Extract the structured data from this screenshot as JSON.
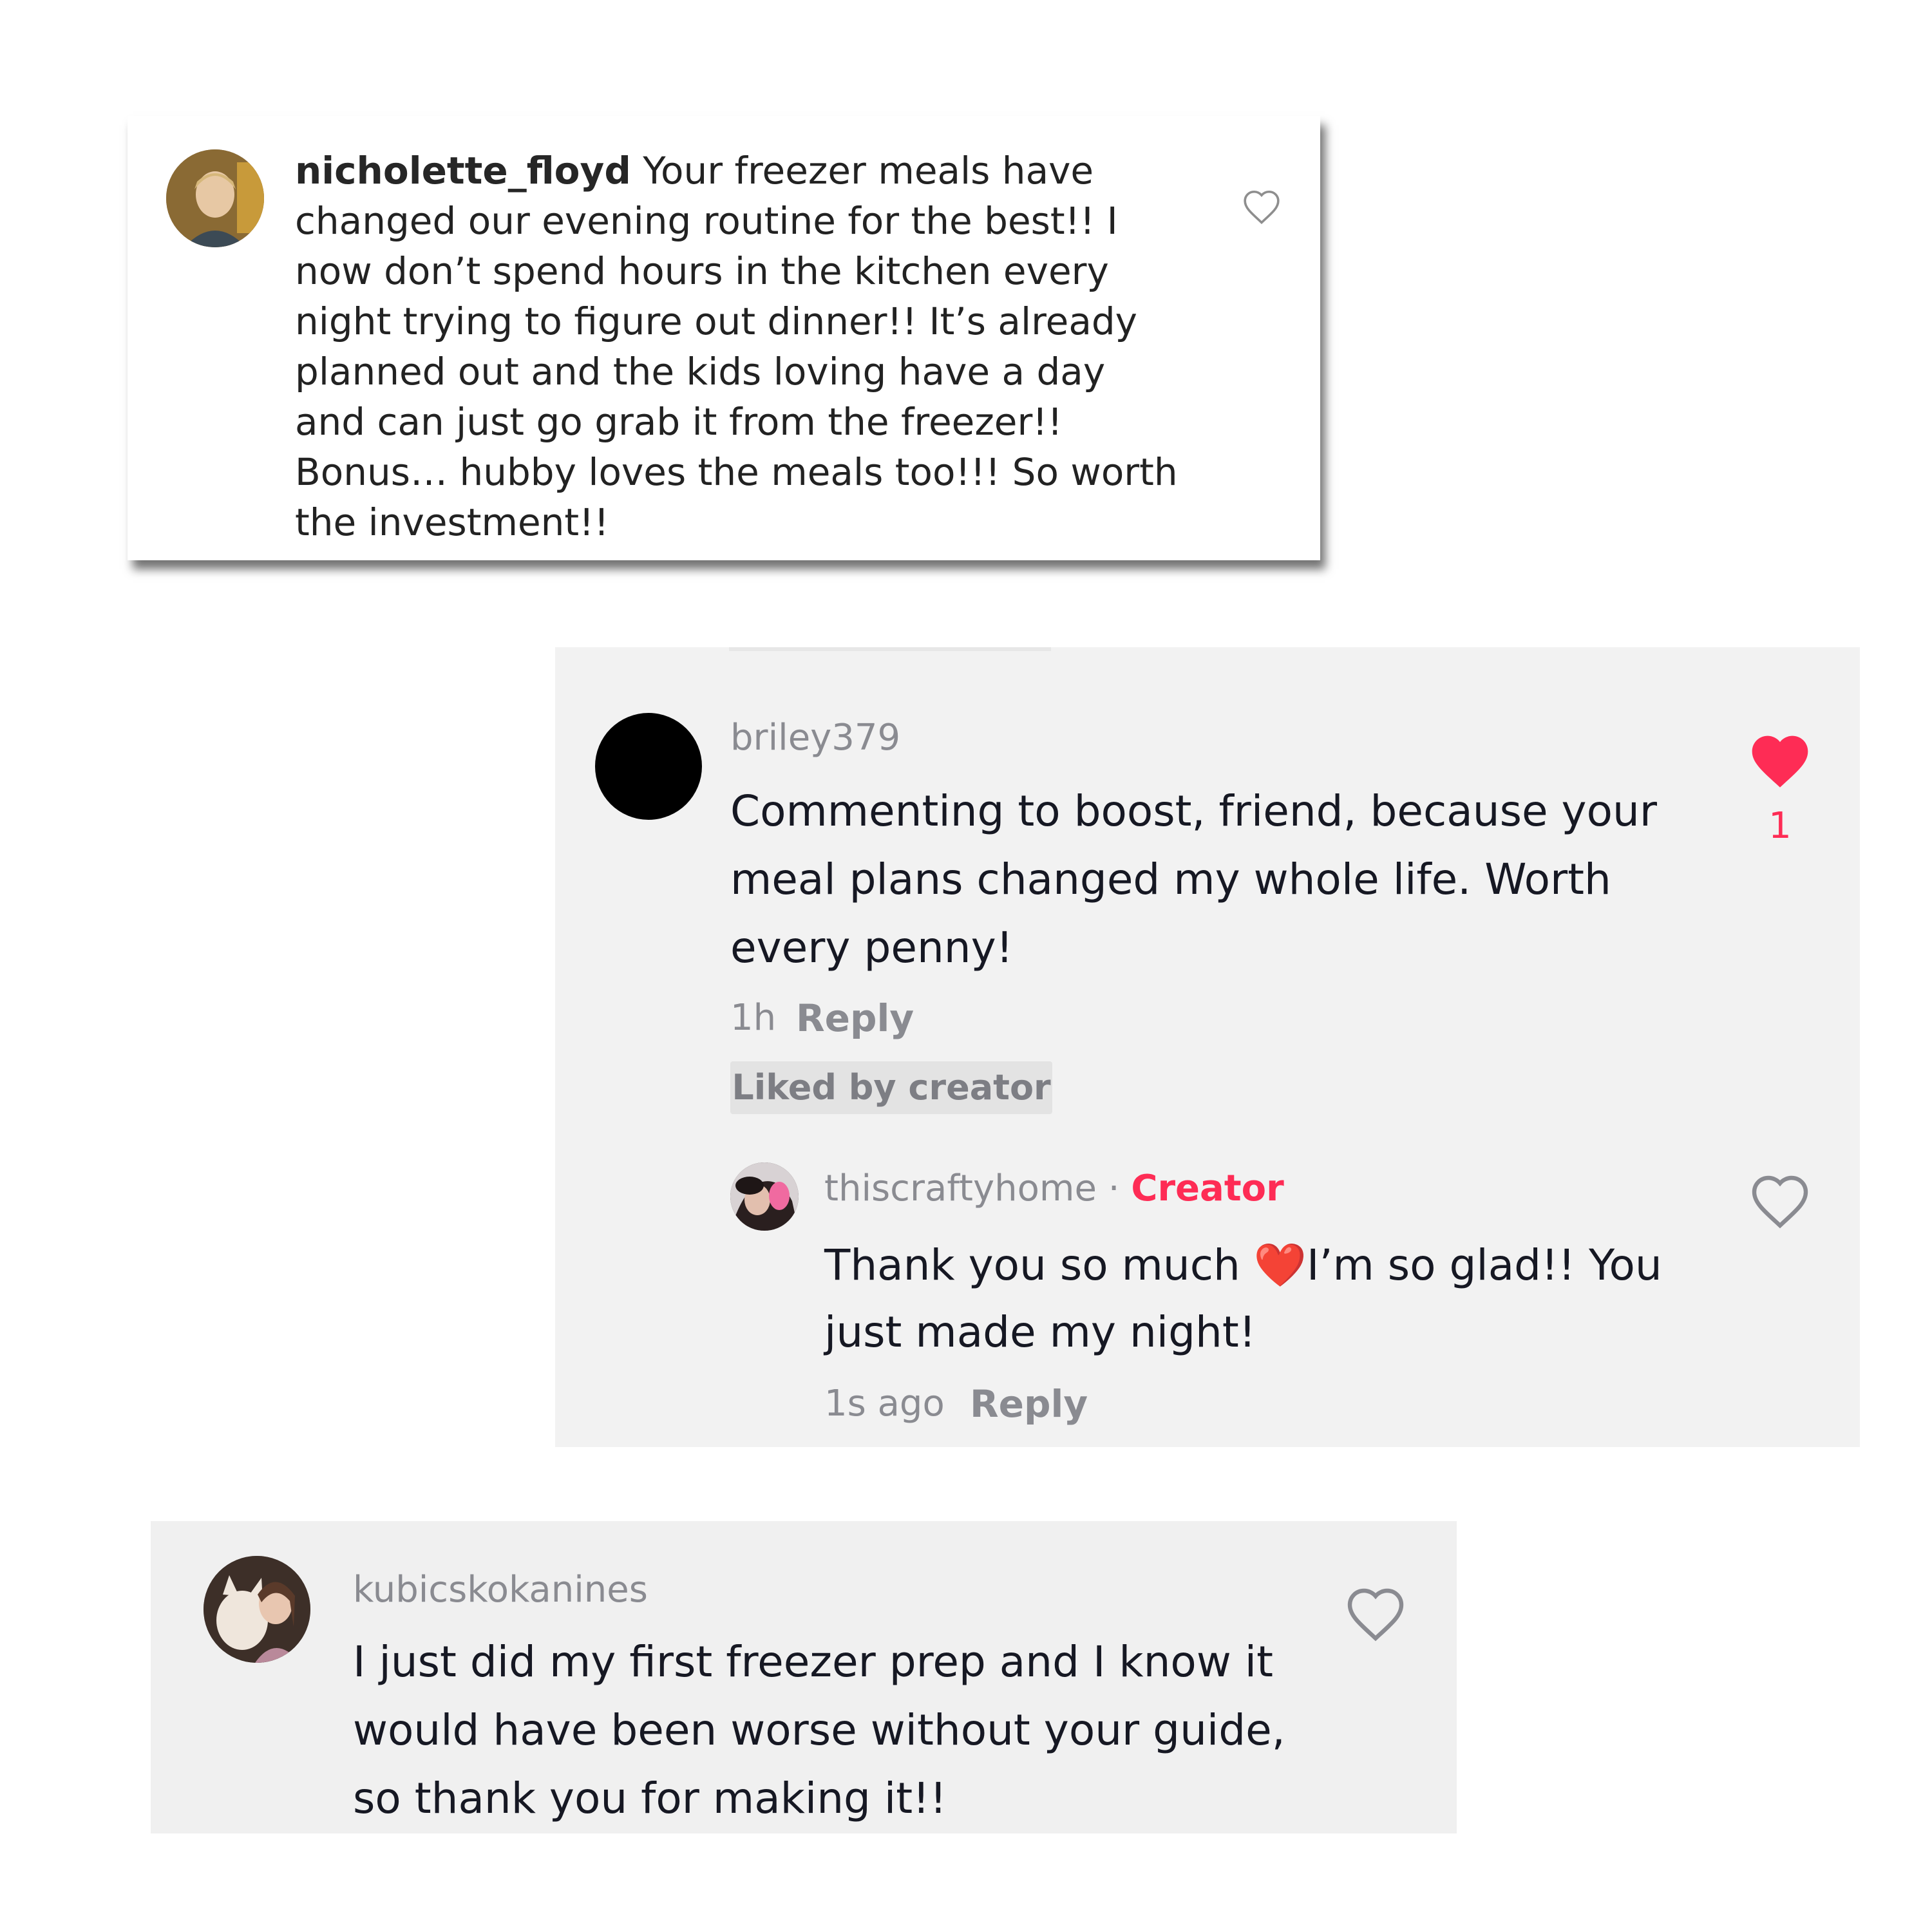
{
  "comment1": {
    "username": "nicholette_floyd",
    "text": " Your freezer meals have changed our evening routine for the best!! I now don’t spend hours in the kitchen every night trying to figure out dinner!! It’s already planned out and the kids loving have a day and can just go grab it from the freezer!! Bonus… hubby loves the meals too!!! So worth the investment!!",
    "like_icon": "heart-outline-icon"
  },
  "comment2": {
    "username": "briley379",
    "text": "Commenting to boost, friend, because your meal plans changed my whole life. Worth every penny!",
    "time": "1h",
    "reply_label": "Reply",
    "liked_badge": "Liked by creator",
    "like_count": "1",
    "like_icon": "heart-filled-icon",
    "like_color": "#fe2c55"
  },
  "reply": {
    "username": "thiscraftyhome",
    "separator": "·",
    "badge": "Creator",
    "text_before": "Thank you so much ",
    "emoji": "❤️",
    "text_after": "I’m so glad!! You just made my night!",
    "time": "1s ago",
    "reply_label": "Reply",
    "like_icon": "heart-outline-icon"
  },
  "comment3": {
    "username": "kubicskokanines",
    "text": "I just did my first freezer prep and I know it would have been worse without your guide, so thank you for making it!!",
    "like_icon": "heart-outline-icon"
  }
}
